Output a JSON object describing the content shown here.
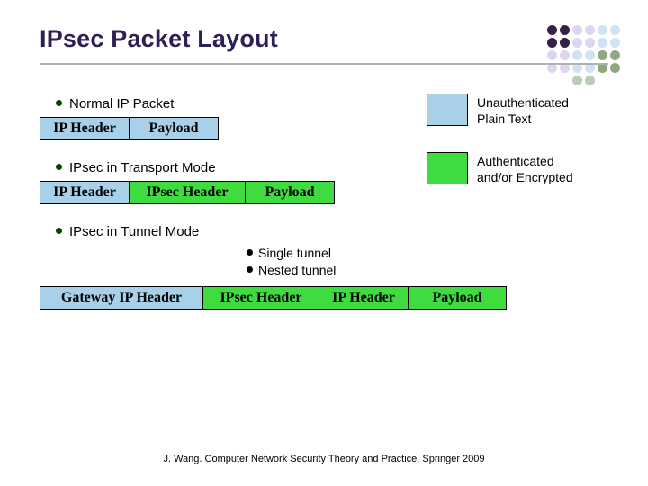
{
  "title": "IPsec Packet Layout",
  "legend": {
    "plain": "Unauthenticated\nPlain Text",
    "auth": "Authenticated\nand/or Encrypted"
  },
  "sections": {
    "normal": {
      "label": "Normal IP Packet",
      "cells": {
        "ip": "IP Header",
        "payload": "Payload"
      }
    },
    "transport": {
      "label": "IPsec in Transport Mode",
      "cells": {
        "ip": "IP Header",
        "ipsec": "IPsec Header",
        "payload": "Payload"
      }
    },
    "tunnel": {
      "label": "IPsec in Tunnel Mode",
      "sub": {
        "single": "Single tunnel",
        "nested": "Nested tunnel"
      },
      "cells": {
        "gateway": "Gateway IP Header",
        "ipsec": "IPsec Header",
        "ip": "IP Header",
        "payload": "Payload"
      }
    }
  },
  "footer": "J. Wang. Computer Network Security Theory and Practice. Springer 2009",
  "colors": {
    "plain": "#a8d1e9",
    "auth": "#3fdc40"
  }
}
